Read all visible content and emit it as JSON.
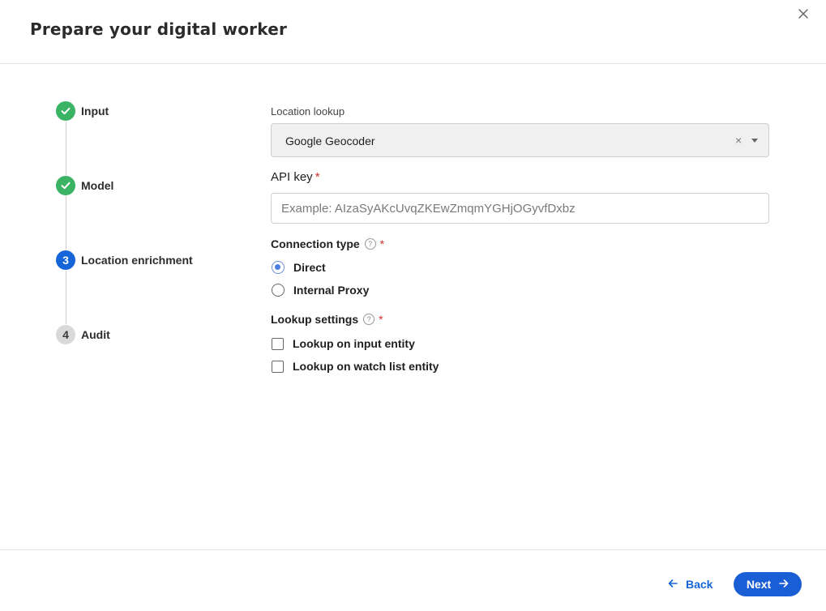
{
  "dialog": {
    "title": "Prepare your digital worker",
    "close_icon": "close-icon"
  },
  "steps": [
    {
      "label": "Input",
      "status": "done",
      "marker": ""
    },
    {
      "label": "Model",
      "status": "done",
      "marker": ""
    },
    {
      "label": "Location enrichment",
      "status": "active",
      "marker": "3"
    },
    {
      "label": "Audit",
      "status": "todo",
      "marker": "4"
    }
  ],
  "location_lookup": {
    "label": "Location lookup",
    "value": "Google Geocoder",
    "clear": "×"
  },
  "api_key": {
    "label": "API key",
    "required": "*",
    "value": "",
    "placeholder": "Example: AIzaSyAKcUvqZKEwZmqmYGHjOGyvfDxbz"
  },
  "connection_type": {
    "label": "Connection type",
    "help": "?",
    "required": "*",
    "options": [
      {
        "label": "Direct",
        "checked": true
      },
      {
        "label": "Internal Proxy",
        "checked": false
      }
    ]
  },
  "lookup_settings": {
    "label": "Lookup settings",
    "help": "?",
    "required": "*",
    "options": [
      {
        "label": "Lookup on input entity",
        "checked": false
      },
      {
        "label": "Lookup on watch list entity",
        "checked": false
      }
    ]
  },
  "footer": {
    "back_label": "Back",
    "next_label": "Next"
  },
  "colors": {
    "primary": "#1a5ed6",
    "success": "#3bb365",
    "required": "#d32f2f",
    "pending": "#d9d9d9"
  }
}
